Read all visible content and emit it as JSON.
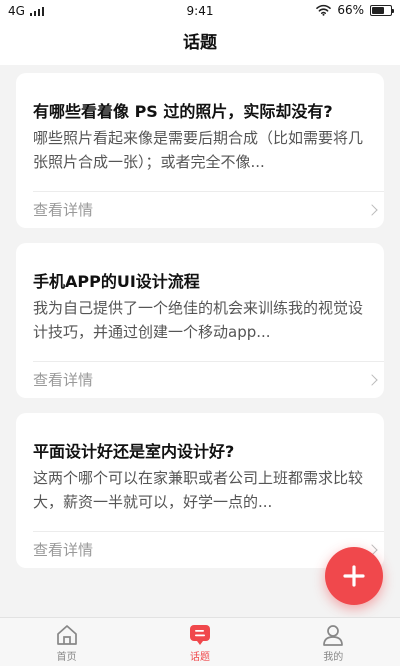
{
  "status_bar": {
    "network": "4G",
    "time": "9:41",
    "battery": "66%",
    "battery_level": 0.66,
    "icons": [
      "signal-icon",
      "wifi-icon",
      "battery-icon"
    ]
  },
  "header": {
    "title": "话题"
  },
  "topics": [
    {
      "title": "有哪些看着像 PS 过的照片，实际却没有?",
      "desc": "哪些照片看起来像是需要后期合成（比如需要将几张照片合成一张）；或者完全不像...",
      "more": "查看详情"
    },
    {
      "title": "手机APP的UI设计流程",
      "desc": "我为自己提供了一个绝佳的机会来训练我的视觉设计技巧，并通过创建一个移动app...",
      "more": "查看详情"
    },
    {
      "title": "平面设计好还是室内设计好?",
      "desc": "这两个哪个可以在家兼职或者公司上班都需求比较大，薪资一半就可以，好学一点的...",
      "more": "查看详情"
    }
  ],
  "fab": {
    "icon": "plus-icon",
    "color": "#f0484c"
  },
  "tabbar": {
    "items": [
      {
        "label": "首页",
        "icon": "home-icon",
        "active": false
      },
      {
        "label": "话题",
        "icon": "chat-icon",
        "active": true
      },
      {
        "label": "我的",
        "icon": "user-icon",
        "active": false
      }
    ],
    "accent": "#f0484c"
  }
}
